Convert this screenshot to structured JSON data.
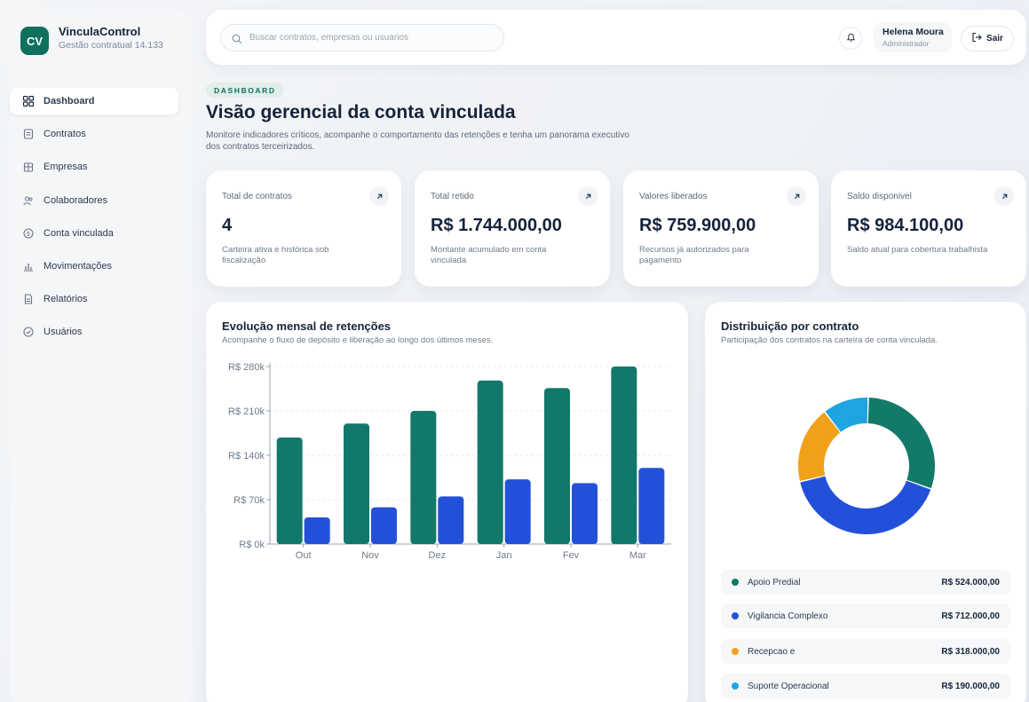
{
  "brand": {
    "logo": "CV",
    "name": "VinculaControl",
    "subtitle": "Gestão contratual 14.133"
  },
  "sidebar": {
    "items": [
      {
        "label": "Dashboard",
        "icon": "grid-icon",
        "active": true
      },
      {
        "label": "Contratos",
        "icon": "contract-icon",
        "active": false
      },
      {
        "label": "Empresas",
        "icon": "building-icon",
        "active": false
      },
      {
        "label": "Colaboradores",
        "icon": "people-icon",
        "active": false
      },
      {
        "label": "Conta vinculada",
        "icon": "coin-icon",
        "active": false
      },
      {
        "label": "Movimentações",
        "icon": "bar-chart-icon",
        "active": false
      },
      {
        "label": "Relatórios",
        "icon": "document-icon",
        "active": false
      },
      {
        "label": "Usuários",
        "icon": "shield-check-icon",
        "active": false
      }
    ]
  },
  "header": {
    "search_placeholder": "Buscar contratos, empresas ou usuarios",
    "user_name": "Helena Moura",
    "user_role": "Administrador",
    "logout_label": "Sair"
  },
  "main": {
    "eyebrow": "DASHBOARD",
    "title": "Visão gerencial da conta vinculada",
    "description": "Monitore indicadores críticos, acompanhe o comportamento das retenções e tenha um panorama executivo dos contratos terceirizados."
  },
  "kpis": [
    {
      "label": "Total de contratos",
      "value": "4",
      "desc": "Carteira ativa e histórica sob fiscalização"
    },
    {
      "label": "Total retido",
      "value": "R$ 1.744.000,00",
      "desc": "Montante acumulado em conta vinculada"
    },
    {
      "label": "Valores liberados",
      "value": "R$ 759.900,00",
      "desc": "Recursos já autorizados para pagamento"
    },
    {
      "label": "Saldo disponivel",
      "value": "R$ 984.100,00",
      "desc": "Saldo atual para cobertura trabalhista"
    }
  ],
  "bar_card": {
    "title": "Evolução mensal de retenções",
    "subtitle": "Acompanhe o fluxo de depósito e liberação ao longo dos últimos meses."
  },
  "donut_card": {
    "title": "Distribuição por contrato",
    "subtitle": "Participação dos contratos na carteira de conta vinculada."
  },
  "chart_data": [
    {
      "type": "bar",
      "categories": [
        "Out",
        "Nov",
        "Dez",
        "Jan",
        "Fev",
        "Mar"
      ],
      "series": [
        {
          "color": "#12796a",
          "values": [
            168000,
            190000,
            210000,
            258000,
            246000,
            280000
          ]
        },
        {
          "color": "#2350d8",
          "values": [
            42000,
            58000,
            75000,
            102000,
            96000,
            120000
          ]
        }
      ],
      "yticks": [
        "R$ 0k",
        "R$ 70k",
        "R$ 140k",
        "R$ 210k",
        "R$ 280k"
      ],
      "ylim": [
        0,
        280000
      ],
      "grid": true
    },
    {
      "type": "pie",
      "donut": true,
      "slices": [
        {
          "label": "Apoio Predial",
          "display": "R$ 524.000,00",
          "value": 524000,
          "color": "#137a6a"
        },
        {
          "label": "Vigilancia Complexo",
          "display": "R$ 712.000,00",
          "value": 712000,
          "color": "#2350d8"
        },
        {
          "label": "Recepcao e",
          "display": "R$ 318.000,00",
          "value": 318000,
          "color": "#f0a11a"
        },
        {
          "label": "Suporte Operacional",
          "display": "R$ 190.000,00",
          "value": 190000,
          "color": "#1ea4e0"
        }
      ]
    }
  ]
}
